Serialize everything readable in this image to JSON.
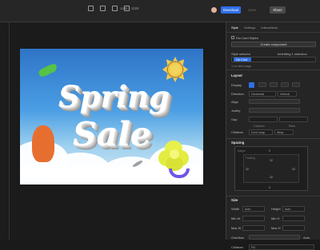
{
  "topbar": {
    "viewport": "1440 × 1028",
    "download": "Download",
    "zoom": "100%",
    "share": "Share",
    "devices": [
      "desktop-icon",
      "tablet-icon",
      "mobile-landscape-icon",
      "mobile-portrait-icon"
    ]
  },
  "poster": {
    "line1": "Spring",
    "line2": "Sale"
  },
  "panel": {
    "tabs": [
      "Style",
      "Settings",
      "Interactions"
    ],
    "styles_checkbox": "Div-Card Styles",
    "create_component": "Create component",
    "style_selector": "Style selector",
    "inheriting": "Inheriting  1 selection",
    "selector_chip": "Div-Card",
    "on_page": "1 on this page",
    "layout_title": "Layout",
    "display_label": "Display",
    "display_value": "Flex",
    "direction_label": "Direction",
    "direction_h": "Horizontal",
    "direction_v": "Vertical",
    "align_label": "Align",
    "justify_label": "Justify",
    "gap_label": "Gap",
    "gap_col": "Column",
    "gap_row": "Row",
    "children_label": "Children",
    "children_value": "Don't wrap",
    "wrap_value": "Wrap",
    "spacing_title": "Spacing",
    "margin_label": "Margin",
    "padding_label": "Padding",
    "spacing_values": [
      "0",
      "32",
      "32",
      "32",
      "32",
      "0"
    ],
    "size_title": "Size",
    "width_label": "Width",
    "width_value": "Auto",
    "height_label": "Height",
    "height_value": "Auto",
    "minw_label": "Min W",
    "minh_label": "Min H",
    "maxw_label": "Max W",
    "maxh_label": "Max H",
    "overflow_label": "Overflow",
    "overflow_value": "Auto",
    "fit_label": "Children",
    "fit_value": "Fill"
  }
}
